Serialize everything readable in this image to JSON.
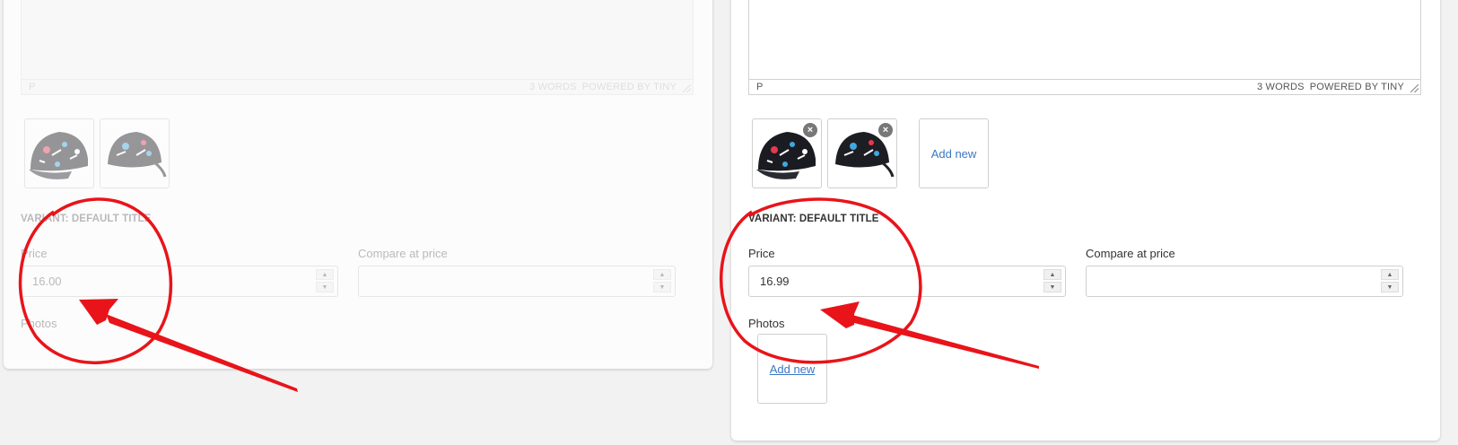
{
  "left_panel": {
    "editor": {
      "path": "P",
      "word_count": "3 WORDS",
      "brand": "POWERED BY TINY"
    },
    "thumbnails": [
      {
        "icon": "cap-photo"
      },
      {
        "icon": "cap-photo"
      }
    ],
    "variant_title": "VARIANT: DEFAULT TITLE",
    "price_label": "Price",
    "price_value": "16.00",
    "compare_label": "Compare at price",
    "compare_value": "",
    "photos_label": "Photos"
  },
  "right_panel": {
    "editor": {
      "path": "P",
      "word_count": "3 WORDS",
      "brand": "POWERED BY TINY"
    },
    "thumbnails": [
      {
        "icon": "cap-photo",
        "remove": "×"
      },
      {
        "icon": "cap-photo",
        "remove": "×"
      }
    ],
    "add_new_label": "Add new",
    "variant_title": "VARIANT: DEFAULT TITLE",
    "price_label": "Price",
    "price_value": "16.99",
    "compare_label": "Compare at price",
    "compare_value": "",
    "photos_label": "Photos",
    "photos_add_new_label": "Add new"
  },
  "spinner": {
    "up": "▲",
    "down": "▼"
  },
  "colors": {
    "annotation": "#e8141a",
    "link": "#3b78c4"
  }
}
